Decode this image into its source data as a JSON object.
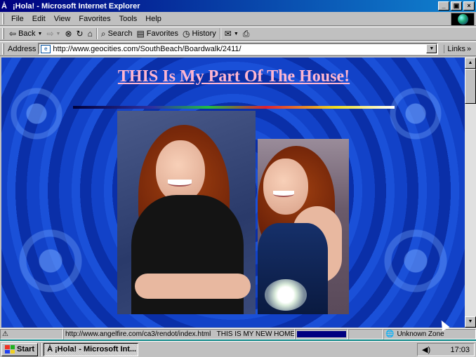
{
  "window": {
    "title": "¡Hola! - Microsoft Internet Explorer",
    "title_icon": "ie-page-icon",
    "controls": {
      "minimize": "_",
      "maximize": "▣",
      "close": "×"
    }
  },
  "menu": {
    "items": [
      "File",
      "Edit",
      "View",
      "Favorites",
      "Tools",
      "Help"
    ]
  },
  "toolbar": {
    "back": "Back",
    "search": "Search",
    "favorites": "Favorites",
    "history": "History"
  },
  "address": {
    "label": "Address",
    "url": "http://www.geocities.com/SouthBeach/Boardwalk/2411/",
    "links": "Links"
  },
  "page": {
    "title": "THIS Is My Part Of The House!",
    "title_color": "#ffb6d0",
    "background_color": "#1038c0"
  },
  "status": {
    "hover_url": "http://www.angelfire.com/ca3/rendot/index.html",
    "message": "THIS IS MY NEW HOMEPAG",
    "zone": "Unknown Zone"
  },
  "taskbar": {
    "start": "Start",
    "task": "¡Hola! - Microsoft Int...",
    "clock": "17:03"
  }
}
